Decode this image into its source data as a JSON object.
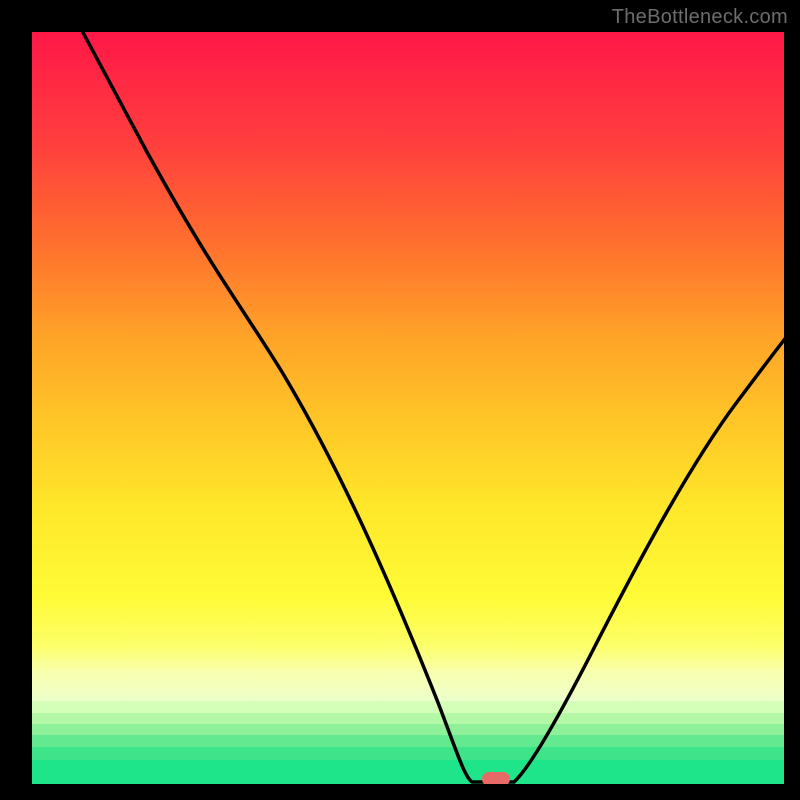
{
  "watermark": "TheBottleneck.com",
  "colors": {
    "background": "#000000",
    "gradient_top": "#ff1848",
    "gradient_mid": "#ffe82a",
    "gradient_green": "#1fe58a",
    "marker": "#e86a66",
    "curve": "#000000"
  },
  "chart_data": {
    "type": "line",
    "title": "",
    "xlabel": "",
    "ylabel": "",
    "xlim": [
      0,
      100
    ],
    "ylim": [
      0,
      100
    ],
    "x": [
      0,
      5,
      10,
      15,
      20,
      25,
      30,
      35,
      40,
      45,
      50,
      55,
      57,
      60,
      63,
      65,
      70,
      75,
      80,
      85,
      90,
      95,
      100
    ],
    "values": [
      105,
      98,
      91,
      84,
      77,
      70,
      60,
      49,
      38,
      27,
      16,
      6,
      2,
      0,
      0,
      2,
      10,
      21,
      33,
      46,
      58,
      63,
      66
    ],
    "plateau_range": [
      58,
      64
    ],
    "marker": {
      "x": 61,
      "y": 0
    },
    "annotations": []
  }
}
